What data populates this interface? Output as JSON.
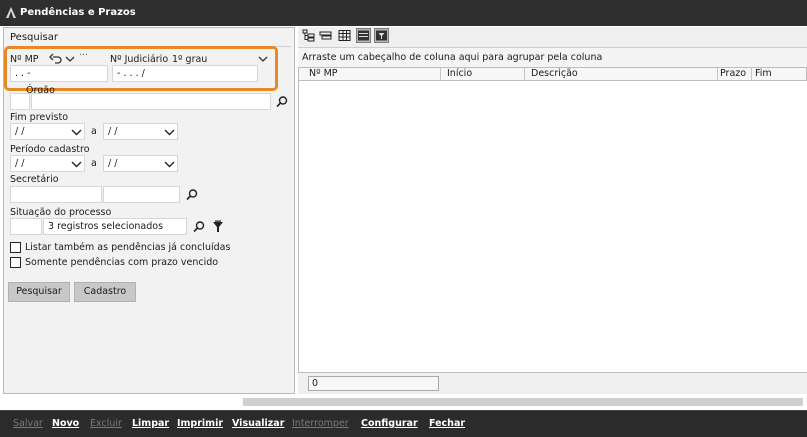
{
  "window": {
    "title": "Pendências e Prazos"
  },
  "search": {
    "title": "Pesquisar",
    "nmp_label": "Nº MP",
    "nmp_value": ".  .       -",
    "njud_label": "Nº Judiciário",
    "grau_value": "1º grau",
    "njud_value": "-  .   .  .  /",
    "orgao_label": "Órgão",
    "fim_previsto_label": "Fim previsto",
    "date_placeholder": " /  /",
    "a_label": "a",
    "periodo_label": "Período cadastro",
    "secretario_label": "Secretário",
    "situacao_label": "Situação do processo",
    "situacao_value": "3 registros selecionados",
    "chk_concluidas_label": "Listar também as pendências já concluídas",
    "chk_vencido_label": "Somente pendências com prazo vencido",
    "btn_pesquisar": "Pesquisar",
    "btn_cadastro": "Cadastro"
  },
  "grid": {
    "group_hint": "Arraste um cabeçalho de coluna aqui para agrupar pela coluna",
    "columns": [
      "Nº MP",
      "Início",
      "Descrição",
      "Prazo",
      "Fim"
    ],
    "record_count": "0"
  },
  "footer": {
    "salvar": "Salvar",
    "novo": "Novo",
    "excluir": "Excluir",
    "limpar": "Limpar",
    "imprimir": "Imprimir",
    "visualizar": "Visualizar",
    "interromper": "Interromper",
    "configurar": "Configurar",
    "fechar": "Fechar"
  },
  "colors": {
    "highlight": "#e58a24",
    "titlebar": "#2f2f2f",
    "footer": "#2b2b2b"
  },
  "icons": [
    "app-icon",
    "undo-icon",
    "chevron-down-icon",
    "ellipsis-icon",
    "search-icon",
    "clear-filter-icon",
    "grid-toolbar-icons"
  ]
}
